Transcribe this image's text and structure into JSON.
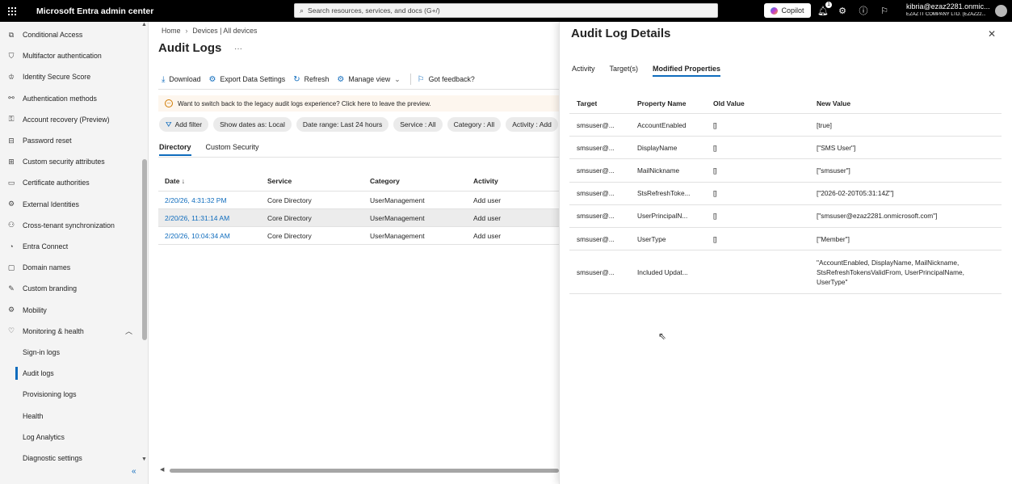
{
  "topbar": {
    "app_title": "Microsoft Entra admin center",
    "search_placeholder": "Search resources, services, and docs (G+/)",
    "copilot_label": "Copilot",
    "notification_count": "1",
    "account_name": "kibria@ezaz2281.onmic...",
    "account_tenant": "EZAZ IT COMPANY LTD. (EZAZ22..."
  },
  "sidebar": {
    "items": [
      {
        "label": "Conditional Access",
        "icon": "conditional-access-icon",
        "glyph": "⧉"
      },
      {
        "label": "Multifactor authentication",
        "icon": "shield-icon",
        "glyph": "⛉"
      },
      {
        "label": "Identity Secure Score",
        "icon": "trophy-icon",
        "glyph": "♔"
      },
      {
        "label": "Authentication methods",
        "icon": "fingerprint-icon",
        "glyph": "⚯"
      },
      {
        "label": "Account recovery (Preview)",
        "icon": "person-key-icon",
        "glyph": "⚿"
      },
      {
        "label": "Password reset",
        "icon": "password-icon",
        "glyph": "⊟"
      },
      {
        "label": "Custom security attributes",
        "icon": "attributes-icon",
        "glyph": "⊞"
      },
      {
        "label": "Certificate authorities",
        "icon": "certificate-icon",
        "glyph": "▭"
      },
      {
        "label": "External Identities",
        "icon": "external-identities-icon",
        "glyph": "⚙"
      },
      {
        "label": "Cross-tenant synchronization",
        "icon": "sync-people-icon",
        "glyph": "⚇"
      },
      {
        "label": "Entra Connect",
        "icon": "connect-icon",
        "glyph": "◔"
      },
      {
        "label": "Domain names",
        "icon": "domain-icon",
        "glyph": "▢"
      },
      {
        "label": "Custom branding",
        "icon": "branding-icon",
        "glyph": "✎"
      },
      {
        "label": "Mobility",
        "icon": "mobility-icon",
        "glyph": "⚙"
      },
      {
        "label": "Monitoring & health",
        "icon": "heart-pulse-icon",
        "glyph": "♡"
      }
    ],
    "sub_items": [
      {
        "label": "Sign-in logs"
      },
      {
        "label": "Audit logs"
      },
      {
        "label": "Provisioning logs"
      },
      {
        "label": "Health"
      },
      {
        "label": "Log Analytics"
      },
      {
        "label": "Diagnostic settings"
      }
    ],
    "active_sub_item": "Audit logs"
  },
  "main": {
    "breadcrumb": [
      "Home",
      "Devices | All devices"
    ],
    "title": "Audit Logs",
    "toolbar": {
      "download": "Download",
      "export": "Export Data Settings",
      "refresh": "Refresh",
      "manage_view": "Manage view",
      "feedback": "Got feedback?"
    },
    "banner_text": "Want to switch back to the legacy audit logs experience? Click here to leave the preview.",
    "filters": {
      "add_filter": "Add filter",
      "show_dates": "Show dates as: Local",
      "date_range": "Date range: Last 24 hours",
      "service": "Service : All",
      "category": "Category : All",
      "activity": "Activity : Add"
    },
    "tabs": [
      "Directory",
      "Custom Security"
    ],
    "table": {
      "headers": [
        "Date ↓",
        "Service",
        "Category",
        "Activity"
      ],
      "rows": [
        {
          "date": "2/20/26, 4:31:32 PM",
          "service": "Core Directory",
          "category": "UserManagement",
          "activity": "Add user"
        },
        {
          "date": "2/20/26, 11:31:14 AM",
          "service": "Core Directory",
          "category": "UserManagement",
          "activity": "Add user"
        },
        {
          "date": "2/20/26, 10:04:34 AM",
          "service": "Core Directory",
          "category": "UserManagement",
          "activity": "Add user"
        }
      ]
    }
  },
  "panel": {
    "title": "Audit Log Details",
    "tabs": [
      "Activity",
      "Target(s)",
      "Modified Properties"
    ],
    "active_tab": "Modified Properties",
    "table": {
      "headers": [
        "Target",
        "Property Name",
        "Old Value",
        "New Value"
      ],
      "rows": [
        {
          "target": "smsuser@...",
          "property": "AccountEnabled",
          "old": "[]",
          "new": "[true]"
        },
        {
          "target": "smsuser@...",
          "property": "DisplayName",
          "old": "[]",
          "new": "[\"SMS User\"]"
        },
        {
          "target": "smsuser@...",
          "property": "MailNickname",
          "old": "[]",
          "new": "[\"smsuser\"]"
        },
        {
          "target": "smsuser@...",
          "property": "StsRefreshToke...",
          "old": "[]",
          "new": "[\"2026-02-20T05:31:14Z\"]"
        },
        {
          "target": "smsuser@...",
          "property": "UserPrincipalN...",
          "old": "[]",
          "new": "[\"smsuser@ezaz2281.onmicrosoft.com\"]"
        },
        {
          "target": "smsuser@...",
          "property": "UserType",
          "old": "[]",
          "new": "[\"Member\"]"
        },
        {
          "target": "smsuser@...",
          "property": "Included Updat...",
          "old": "",
          "new": "\"AccountEnabled, DisplayName, MailNickname, StsRefreshTokensValidFrom, UserPrincipalName, UserType\""
        }
      ]
    }
  }
}
